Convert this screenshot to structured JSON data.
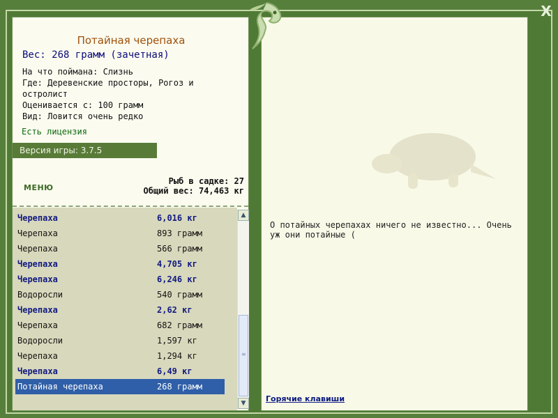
{
  "header": {
    "close_label": "X"
  },
  "fish": {
    "title": "Потайная черепаха",
    "weight": "Вес: 268 грамм (зачетная)",
    "bait": "На что поймана: Слизнь",
    "where_line1": "Где: Деревенские просторы, Рогоз и",
    "where_line2": "остролист",
    "rated": "Оценивается с: 100 грамм",
    "kind": "Вид: Ловится очень редко",
    "license": "Есть лицензия"
  },
  "version": "Версия игры: 3.7.5",
  "menu_label": "МЕНЮ",
  "stats": {
    "count": "Рыб в садке: 27",
    "total": "Общий вес: 74,463 кг"
  },
  "catch_list": [
    {
      "name": "Черепаха",
      "weight": "6,016 кг",
      "style": "bold"
    },
    {
      "name": "Черепаха",
      "weight": "893 грамм",
      "style": "normal"
    },
    {
      "name": "Черепаха",
      "weight": "566 грамм",
      "style": "normal"
    },
    {
      "name": "Черепаха",
      "weight": "4,705 кг",
      "style": "bold"
    },
    {
      "name": "Черепаха",
      "weight": "6,246 кг",
      "style": "bold"
    },
    {
      "name": "Водоросли",
      "weight": "540 грамм",
      "style": "normal"
    },
    {
      "name": "Черепаха",
      "weight": "2,62 кг",
      "style": "bold"
    },
    {
      "name": "Черепаха",
      "weight": "682 грамм",
      "style": "normal"
    },
    {
      "name": "Водоросли",
      "weight": "1,597 кг",
      "style": "normal"
    },
    {
      "name": "Черепаха",
      "weight": "1,294 кг",
      "style": "normal"
    },
    {
      "name": "Черепаха",
      "weight": "6,49 кг",
      "style": "bold"
    },
    {
      "name": "Потайная черепаха",
      "weight": "268 грамм",
      "style": "selected"
    }
  ],
  "description": "О потайных черепахах ничего не известно... Очень уж они потайные (",
  "hotkeys_label": "Горячие клавиши",
  "colors": {
    "frame": "#567f3c",
    "panel": "#fbfbf0",
    "selected": "#2f5fa8",
    "bold_text": "#111a80"
  },
  "icons": {
    "logo": "fish-logo-icon",
    "close": "close-icon",
    "scroll_up": "arrow-up-icon",
    "scroll_down": "arrow-down-icon",
    "turtle": "turtle-icon"
  }
}
